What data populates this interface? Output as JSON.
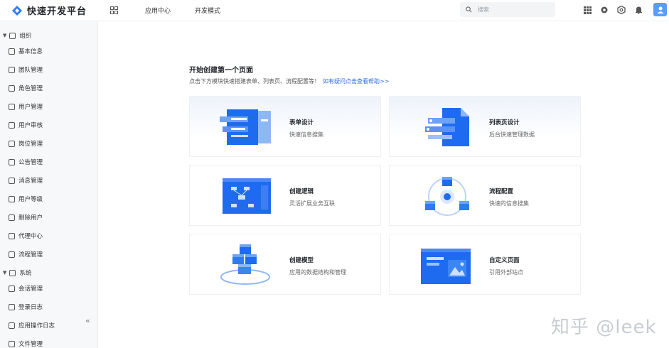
{
  "app": {
    "title": "快速开发平台"
  },
  "header": {
    "nav": [
      "应用中心",
      "开发模式"
    ],
    "search_placeholder": "搜索"
  },
  "sidebar": {
    "groups": [
      {
        "label": "组织",
        "items": [
          "基本信息",
          "团队管理",
          "角色管理",
          "用户管理",
          "用户审核",
          "岗位管理",
          "公告管理",
          "消息管理",
          "用户等级",
          "删除用户",
          "代理中心",
          "流程管理"
        ]
      },
      {
        "label": "系统",
        "items": [
          "会话管理",
          "登录日志",
          "应用操作日志",
          "文件管理"
        ]
      }
    ],
    "collapse_glyph": "«"
  },
  "main": {
    "title": "开始创建第一个页面",
    "subtitle": "点击下方模块快速搭建表单、列表页、流程配置等！",
    "help_link": "如有疑问点击查看帮助>>",
    "cards": [
      {
        "title": "表单设计",
        "desc": "快速信息搜集"
      },
      {
        "title": "列表页设计",
        "desc": "后台快速管理数据"
      },
      {
        "title": "创建逻辑",
        "desc": "灵活扩展业务互联"
      },
      {
        "title": "流程配置",
        "desc": "快速的信息搜集"
      },
      {
        "title": "创建模型",
        "desc": "应用的数据结构和管理"
      },
      {
        "title": "自定义页面",
        "desc": "引用外部站点"
      }
    ]
  },
  "watermark": "知乎 @leek",
  "colors": {
    "accent": "#2e6ce8",
    "primary_blue": "#1f6bf0"
  }
}
